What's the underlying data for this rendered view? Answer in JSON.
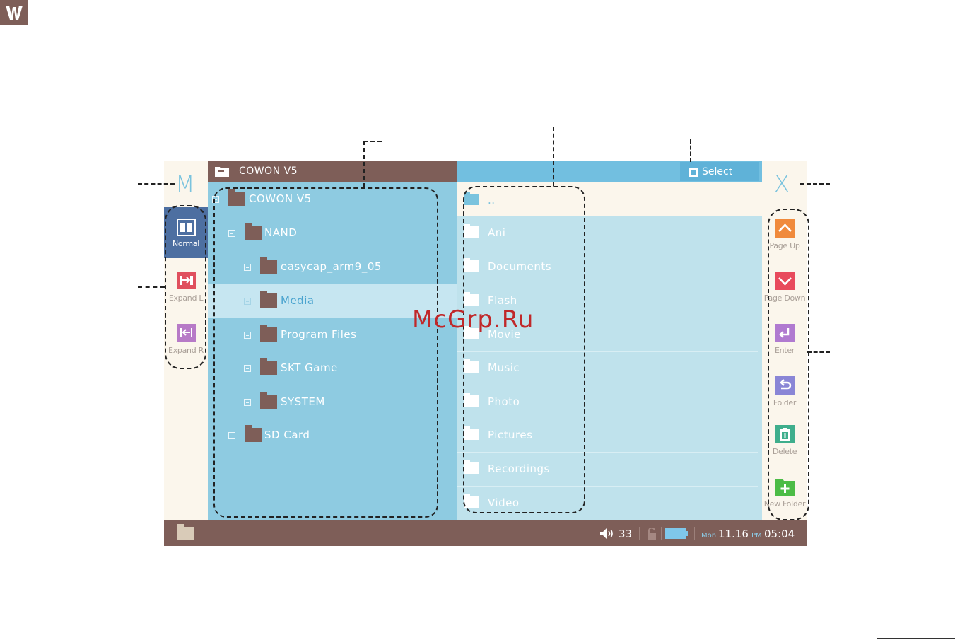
{
  "tree": {
    "header_title": "COWON V5",
    "items": [
      {
        "label": "COWON V5"
      },
      {
        "label": "NAND"
      },
      {
        "label": "easycap_arm9_05"
      },
      {
        "label": "Media"
      },
      {
        "label": "Program Files"
      },
      {
        "label": "SKT Game"
      },
      {
        "label": "SYSTEM"
      },
      {
        "label": "SD Card"
      }
    ]
  },
  "list": {
    "select_label": "Select",
    "up_label": "..",
    "items": [
      {
        "label": "Ani"
      },
      {
        "label": "Documents"
      },
      {
        "label": "Flash"
      },
      {
        "label": "Movie"
      },
      {
        "label": "Music"
      },
      {
        "label": "Photo"
      },
      {
        "label": "Pictures"
      },
      {
        "label": "Recordings"
      },
      {
        "label": "Video"
      }
    ]
  },
  "left_rail": {
    "menu_label": "M",
    "buttons": [
      {
        "label": "Normal",
        "icon": "split-view-icon"
      },
      {
        "label": "Expand L",
        "icon": "expand-left-icon"
      },
      {
        "label": "Expand R",
        "icon": "expand-right-icon"
      }
    ]
  },
  "right_rail": {
    "close_label": "X",
    "buttons": [
      {
        "label": "Page Up",
        "icon": "chevron-up-icon"
      },
      {
        "label": "Page Down",
        "icon": "chevron-down-icon"
      },
      {
        "label": "Enter",
        "icon": "enter-icon"
      },
      {
        "label": "Folder",
        "icon": "folder-back-icon"
      },
      {
        "label": "Delete",
        "icon": "trash-icon"
      },
      {
        "label": "New Folder",
        "icon": "new-folder-icon"
      }
    ]
  },
  "status": {
    "volume": "33",
    "day": "Mon",
    "date": "11.16",
    "ampm": "PM",
    "time": "05:04"
  },
  "watermark": "McGrp.Ru",
  "colors": {
    "brown": "#7e5e58",
    "tree_blue": "#8ecbe1",
    "list_blue": "#bfe2ec",
    "accent": "#72bfe0",
    "cream": "#fbf6ec"
  }
}
